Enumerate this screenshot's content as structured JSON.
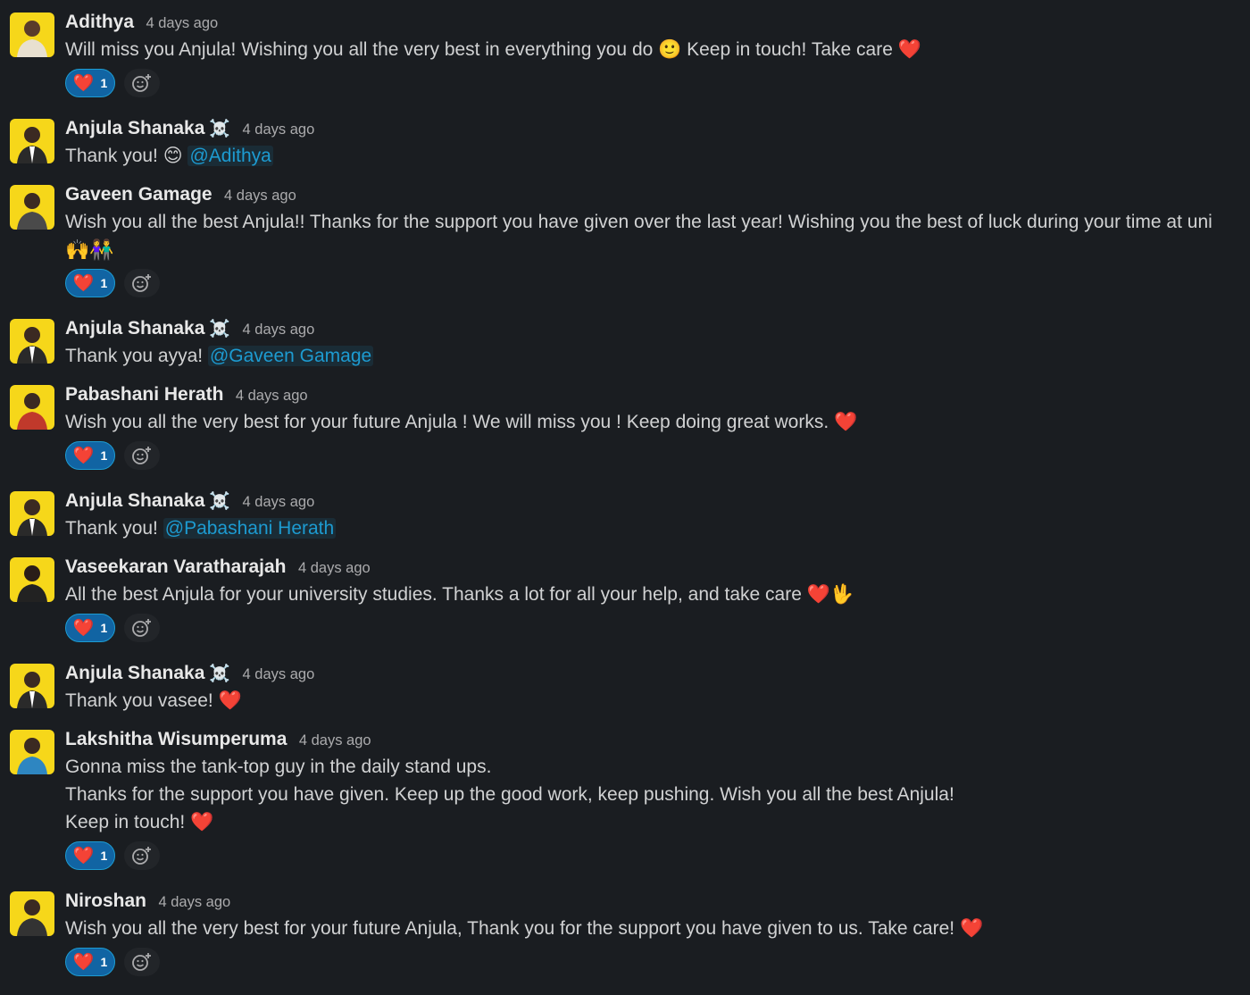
{
  "messages": [
    {
      "author": "Adithya",
      "badge": "",
      "time": "4 days ago",
      "lines": [
        "Will miss you Anjula! Wishing you all the very best in everything you do 🙂 Keep in touch! Take care ❤️"
      ],
      "mention": "",
      "reaction": {
        "emoji": "❤️",
        "count": "1"
      }
    },
    {
      "author": "Anjula Shanaka",
      "badge": "☠️",
      "time": "4 days ago",
      "lines": [
        "Thank you! 😊"
      ],
      "mention": "@Adithya",
      "reaction": null
    },
    {
      "author": "Gaveen Gamage",
      "badge": "",
      "time": "4 days ago",
      "lines": [
        "Wish you all the best Anjula!! Thanks for the support you have given over the last year! Wishing you the best of luck during your time at uni",
        "🙌👫"
      ],
      "mention": "",
      "reaction": {
        "emoji": "❤️",
        "count": "1"
      }
    },
    {
      "author": "Anjula Shanaka",
      "badge": "☠️",
      "time": "4 days ago",
      "lines": [
        "Thank you ayya!"
      ],
      "mention": "@Gaveen Gamage",
      "reaction": null
    },
    {
      "author": "Pabashani Herath",
      "badge": "",
      "time": "4 days ago",
      "lines": [
        "Wish you all the very best for your future Anjula ! We will miss you !  Keep doing great works. ❤️"
      ],
      "mention": "",
      "reaction": {
        "emoji": "❤️",
        "count": "1"
      }
    },
    {
      "author": "Anjula Shanaka",
      "badge": "☠️",
      "time": "4 days ago",
      "lines": [
        "Thank you!"
      ],
      "mention": "@Pabashani Herath",
      "reaction": null
    },
    {
      "author": "Vaseekaran Varatharajah",
      "badge": "",
      "time": "4 days ago",
      "lines": [
        "All the best Anjula for your university studies. Thanks a lot for all your help, and take care ❤️🖖"
      ],
      "mention": "",
      "reaction": {
        "emoji": "❤️",
        "count": "1"
      }
    },
    {
      "author": "Anjula Shanaka",
      "badge": "☠️",
      "time": "4 days ago",
      "lines": [
        "Thank you vasee! ❤️"
      ],
      "mention": "",
      "reaction": null
    },
    {
      "author": "Lakshitha Wisumperuma",
      "badge": "",
      "time": "4 days ago",
      "lines": [
        "Gonna miss the tank-top guy in the daily stand ups.",
        "Thanks for the support you have given.  Keep up the good work, keep pushing. Wish you all the best Anjula!",
        "Keep in touch! ❤️"
      ],
      "mention": "",
      "reaction": {
        "emoji": "❤️",
        "count": "1"
      }
    },
    {
      "author": "Niroshan",
      "badge": "",
      "time": "4 days ago",
      "lines": [
        "Wish you all the very best for your future Anjula, Thank you for the support you have given to us. Take care! ❤️"
      ],
      "mention": "",
      "reaction": {
        "emoji": "❤️",
        "count": "1"
      }
    }
  ],
  "colors": {
    "background": "#1a1d21",
    "mention": "#1d9bd1",
    "reaction_bg": "#1164a3",
    "avatar_bg": "#f6d71a"
  },
  "icons": {
    "add_reaction": "add-reaction-icon"
  }
}
